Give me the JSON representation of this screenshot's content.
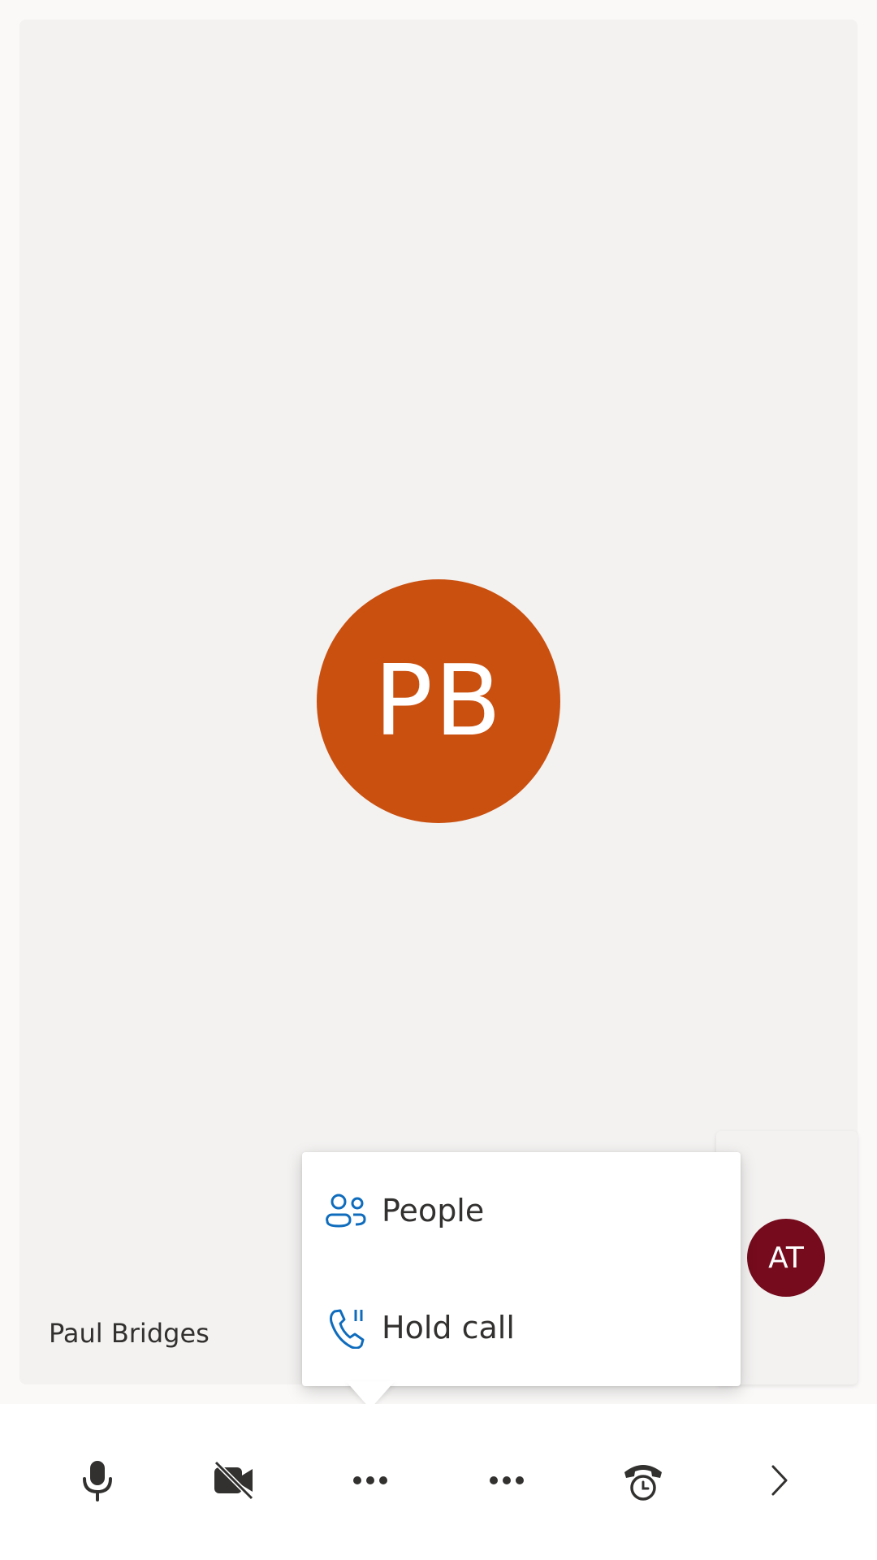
{
  "stage": {
    "participant": {
      "initials": "PB",
      "name": "Paul Bridges",
      "avatar_color": "#ca5010"
    },
    "self_view": {
      "initials": "AT",
      "avatar_color": "#750b1c"
    }
  },
  "more_menu": {
    "items": [
      {
        "label": "People",
        "icon": "people-icon"
      },
      {
        "label": "Hold call",
        "icon": "hold-call-icon"
      }
    ],
    "accent": "#0f6cbd"
  },
  "toolbar": {
    "buttons": [
      {
        "name": "microphone",
        "icon": "microphone-icon"
      },
      {
        "name": "camera-off",
        "icon": "video-off-icon"
      },
      {
        "name": "more-options",
        "icon": "more-icon"
      },
      {
        "name": "more-options-2",
        "icon": "more-icon"
      },
      {
        "name": "hang-up-hold",
        "icon": "phone-clock-icon"
      },
      {
        "name": "next",
        "icon": "chevron-right-icon"
      }
    ]
  }
}
